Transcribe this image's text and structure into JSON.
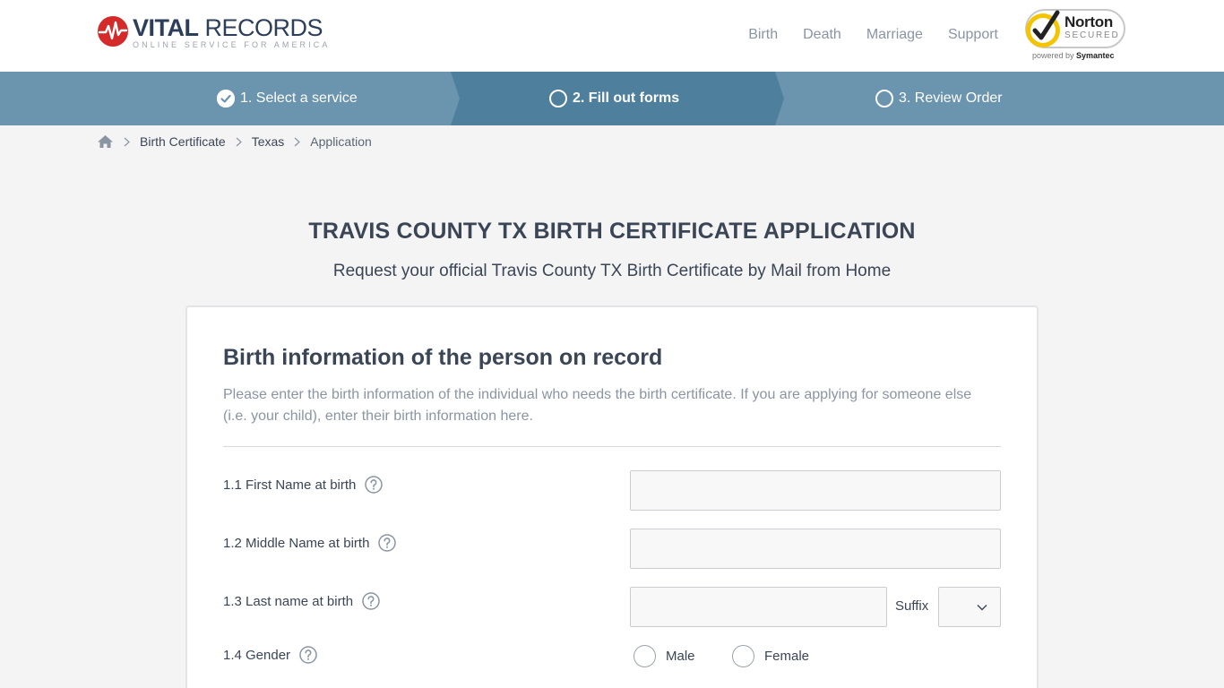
{
  "header": {
    "logo": {
      "word_bold": "VITAL",
      "word_regular": " RECORDS",
      "tagline": "ONLINE SERVICE FOR AMERICA",
      "icon": "heartbeat-icon"
    },
    "nav": [
      {
        "label": "Birth"
      },
      {
        "label": "Death"
      },
      {
        "label": "Marriage"
      },
      {
        "label": "Support"
      }
    ],
    "norton": {
      "name": "Norton",
      "secured": "SECURED",
      "powered_prefix": "powered by ",
      "powered_brand": "Symantec"
    }
  },
  "steps": [
    {
      "label": "1. Select a service",
      "state": "done"
    },
    {
      "label": "2. Fill out forms",
      "state": "active"
    },
    {
      "label": "3. Review Order",
      "state": "pending"
    }
  ],
  "breadcrumb": {
    "home_icon": "home-icon",
    "items": [
      {
        "label": "Birth Certificate"
      },
      {
        "label": "Texas"
      },
      {
        "label": "Application"
      }
    ]
  },
  "page": {
    "title": "TRAVIS COUNTY TX BIRTH CERTIFICATE APPLICATION",
    "subtitle": "Request your official Travis County TX Birth Certificate by Mail from Home"
  },
  "section": {
    "title": "Birth information of the person on record",
    "description": "Please enter the birth information of the individual who needs the birth certificate. If you are applying for someone else (i.e. your child), enter their birth information here.",
    "fields": {
      "first_name": {
        "label": "1.1 First Name at birth",
        "value": ""
      },
      "middle_name": {
        "label": "1.2 Middle Name at birth",
        "value": ""
      },
      "last_name": {
        "label": "1.3 Last name at birth",
        "value": ""
      },
      "suffix": {
        "label": "Suffix",
        "value": ""
      },
      "gender": {
        "label": "1.4 Gender",
        "options": [
          "Male",
          "Female"
        ],
        "selected": null
      }
    }
  },
  "colors": {
    "steps_bar": "#6b94ae",
    "steps_active": "#4e7f9c",
    "text_dark": "#3a4556",
    "text_muted": "#8a95a3",
    "logo_red": "#d42a2a",
    "norton_yellow": "#f5c400"
  }
}
